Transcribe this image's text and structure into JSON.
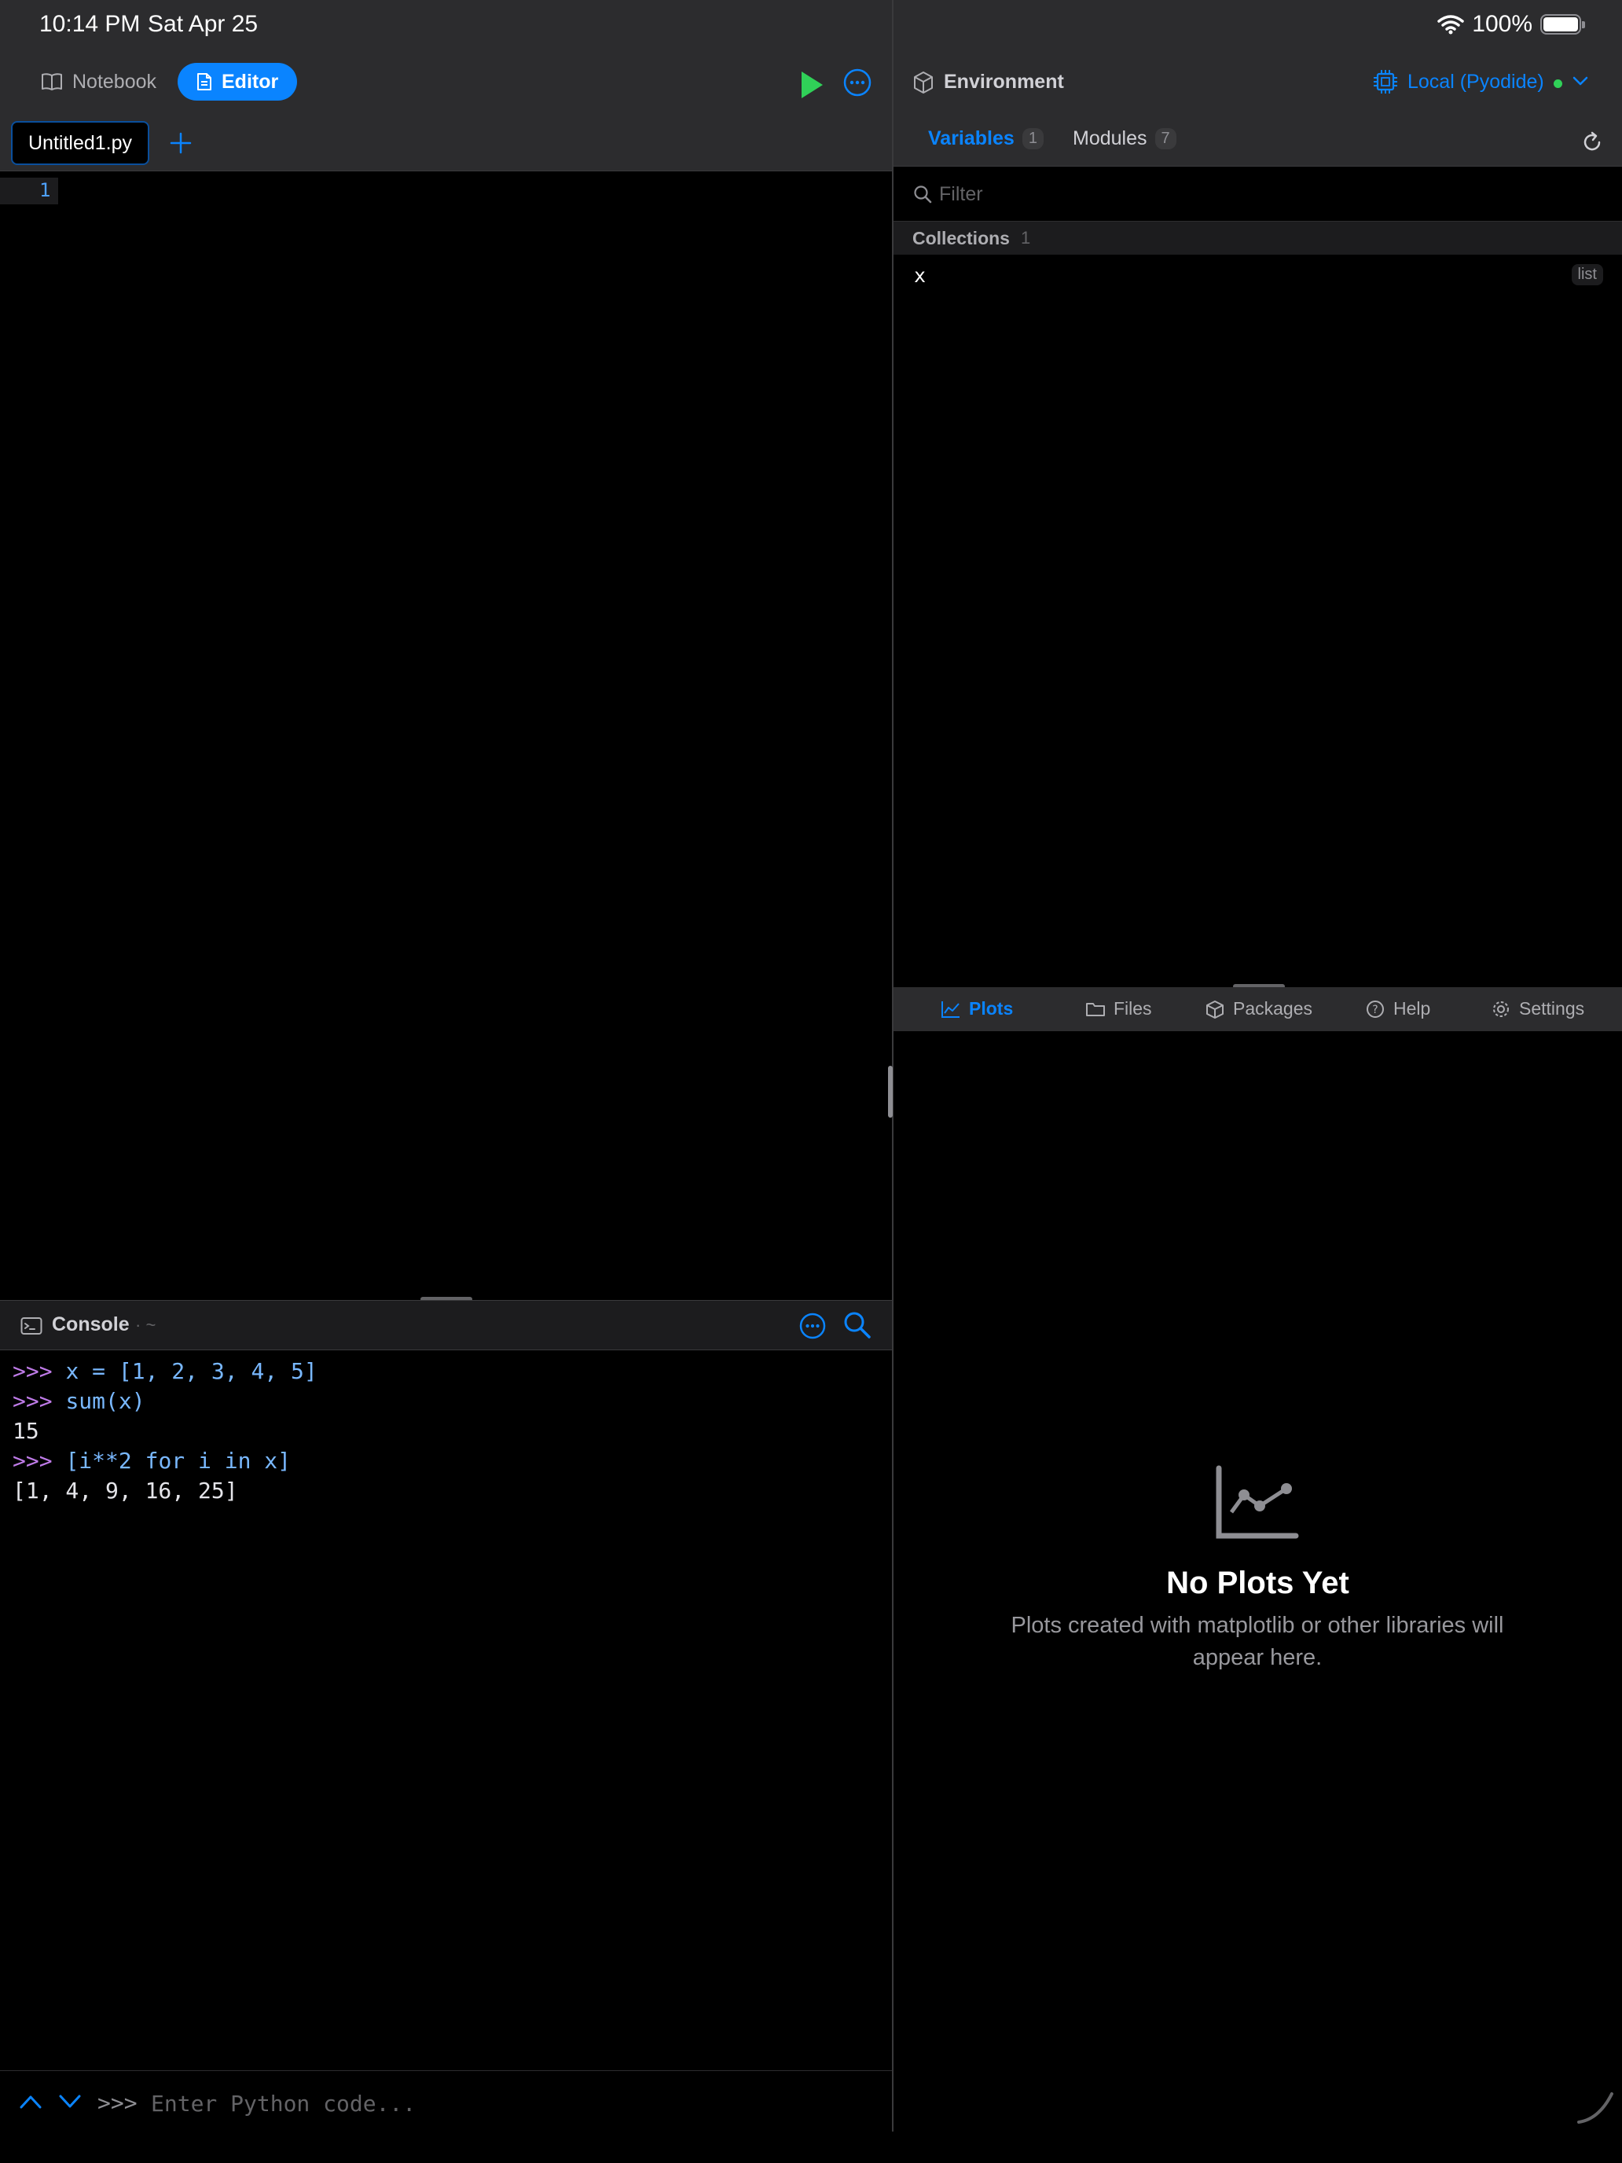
{
  "status_bar": {
    "time": "10:14 PM",
    "date": "Sat Apr 25",
    "battery": "100%"
  },
  "left_toolbar": {
    "notebook_label": "Notebook",
    "editor_label": "Editor"
  },
  "editor": {
    "tab_name": "Untitled1.py",
    "line_numbers": [
      "1"
    ]
  },
  "console": {
    "title": "Console",
    "path": "· ~",
    "lines": [
      {
        "prompt": ">>>",
        "text": "x = [1, 2, 3, 4, 5]"
      },
      {
        "prompt": ">>>",
        "text": "sum(x)"
      },
      {
        "output": "15"
      },
      {
        "prompt": ">>>",
        "text": "[i**2 for i in x]"
      },
      {
        "output": "[1, 4, 9, 16, 25]"
      }
    ],
    "input_prompt": ">>>",
    "input_placeholder": "Enter Python code..."
  },
  "environment": {
    "title": "Environment",
    "kernel": "Local (Pyodide)",
    "kernel_status_color": "#30d158",
    "tabs": [
      {
        "label": "Variables",
        "count": "1"
      },
      {
        "label": "Modules",
        "count": "7"
      }
    ],
    "filter_placeholder": "Filter",
    "section": {
      "title": "Collections",
      "count": "1"
    },
    "variables": [
      {
        "name": "x",
        "type": "list"
      }
    ]
  },
  "bottom_tabs": [
    "Plots",
    "Files",
    "Packages",
    "Help",
    "Settings"
  ],
  "plots": {
    "empty_title": "No Plots Yet",
    "empty_subtitle": "Plots created with matplotlib or other libraries will appear here."
  },
  "colors": {
    "accent": "#0a84ff",
    "run": "#30d158",
    "prompt": "#bf7be8",
    "code": "#79b8ff"
  }
}
